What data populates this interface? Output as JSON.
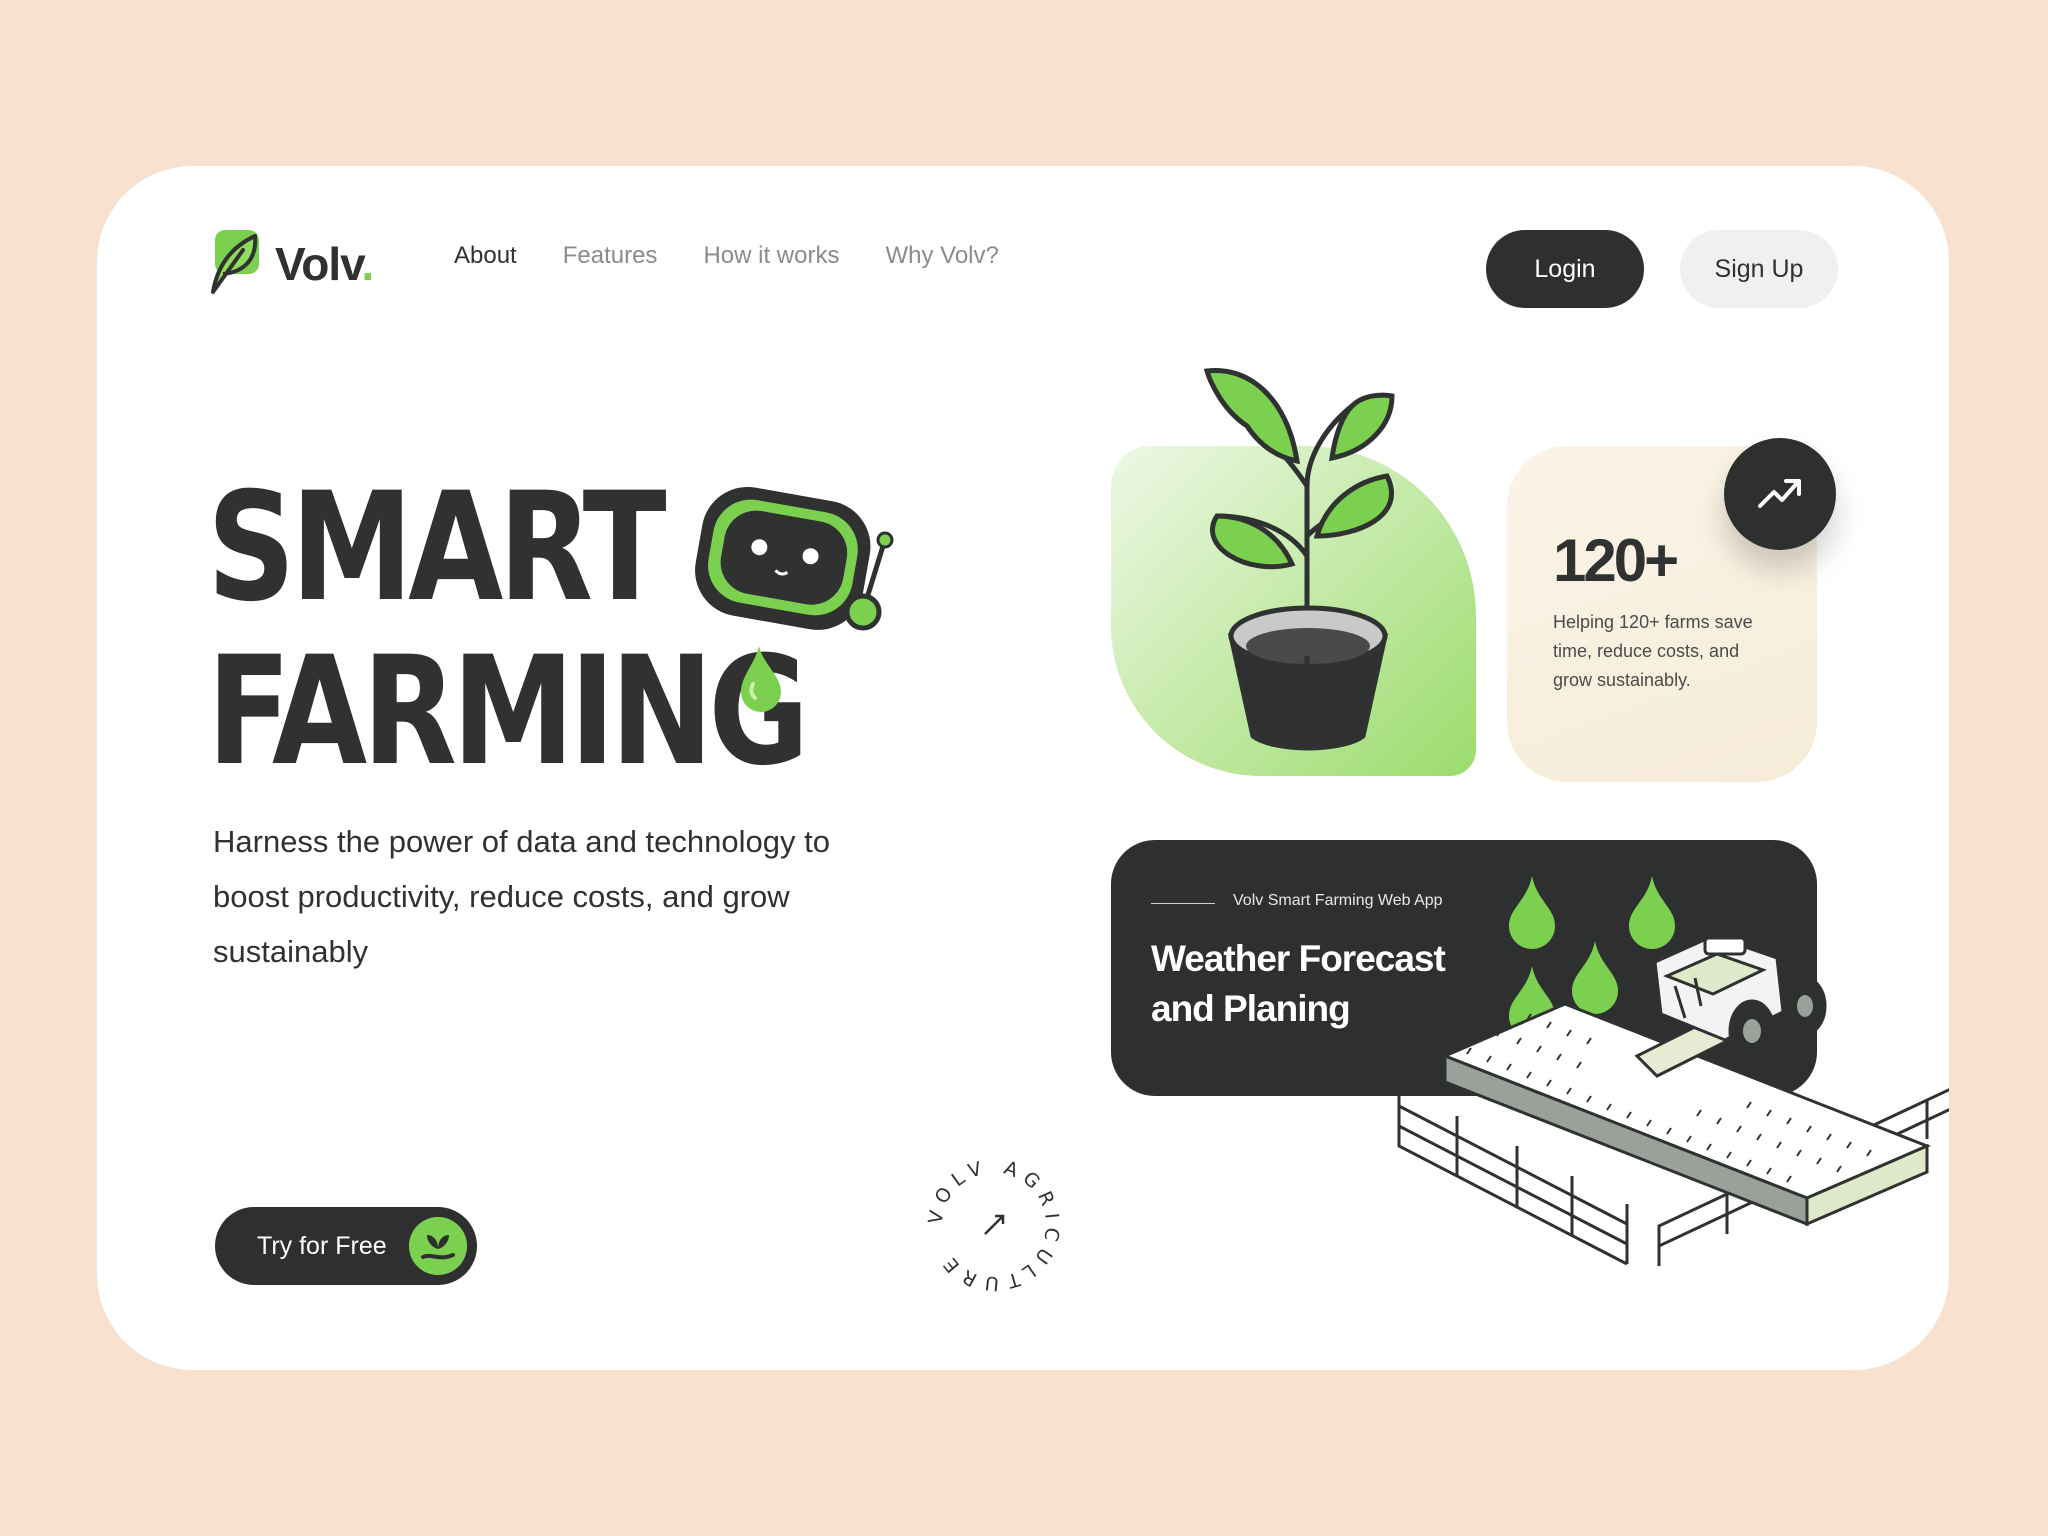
{
  "brand": {
    "name": "Volv",
    "dot": "."
  },
  "nav": {
    "items": [
      {
        "label": "About"
      },
      {
        "label": "Features"
      },
      {
        "label": "How it works"
      },
      {
        "label": "Why Volv?"
      }
    ]
  },
  "auth": {
    "login": "Login",
    "signup": "Sign Up"
  },
  "hero": {
    "line1": "SMART",
    "line2": "FARMING",
    "subtitle": "Harness the power of data and technology to boost productivity, reduce costs, and grow sustainably",
    "cta": "Try for Free"
  },
  "badge": {
    "text": "VOLV AGRICULTURE"
  },
  "stat": {
    "value": "120+",
    "description": "Helping 120+ farms save time, reduce costs, and grow sustainably."
  },
  "weather": {
    "tag": "Volv Smart Farming  Web App",
    "title": "Weather Forecast and Planing"
  },
  "colors": {
    "background": "#f8e1cf",
    "accent": "#7cd04f",
    "dark": "#2e302f"
  },
  "icons": [
    "leaf-logo-icon",
    "robot-icon",
    "trend-up-icon",
    "plant-hand-icon",
    "arrow-icon",
    "water-drop-icon",
    "tractor-icon"
  ]
}
